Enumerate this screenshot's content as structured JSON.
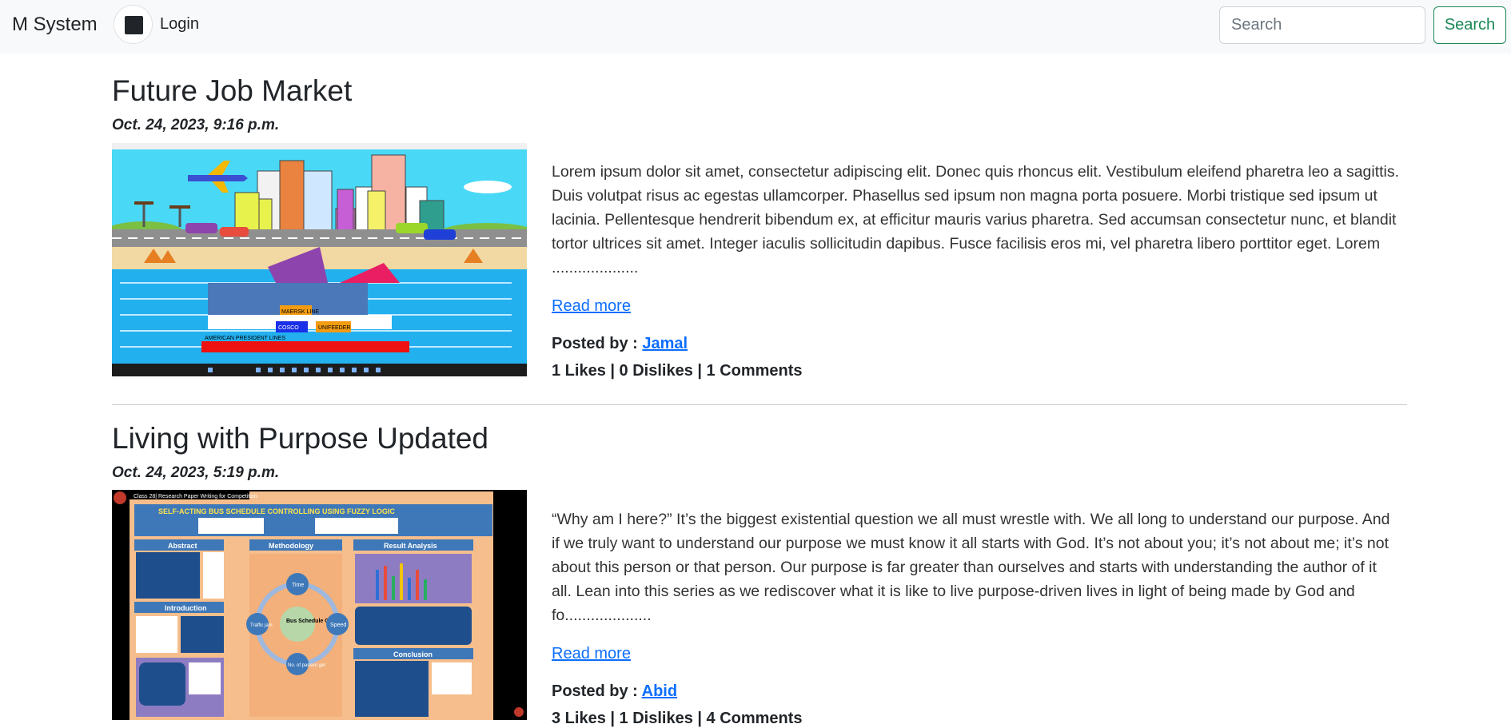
{
  "navbar": {
    "brand": "M System",
    "login_label": "Login",
    "search_placeholder": "Search",
    "search_button": "Search"
  },
  "posts": [
    {
      "title": "Future Job Market",
      "date": "Oct. 24, 2023, 9:16 p.m.",
      "excerpt": "Lorem ipsum dolor sit amet, consectetur adipiscing elit. Donec quis rhoncus elit. Vestibulum eleifend pharetra leo a sagittis. Duis volutpat risus ac egestas ullamcorper. Phasellus sed ipsum non magna porta posuere. Morbi tristique sed ipsum ut lacinia. Pellentesque hendrerit bibendum ex, at efficitur mauris varius pharetra. Sed accumsan consectetur nunc, et blandit tortor ultrices sit amet. Integer iaculis sollicitudin dapibus. Fusce facilisis eros mi, vel pharetra libero porttitor eget. Lorem ....................",
      "read_more": "Read more",
      "posted_by_label": "Posted by :",
      "author": "Jamal",
      "stats": "1 Likes | 0 Dislikes | 1 Comments",
      "image_labels": [
        "MAERSK LINE",
        "COSCO",
        "UNIFEEDER",
        "AMERICAN PRESIDENT LINES"
      ]
    },
    {
      "title": "Living with Purpose Updated",
      "date": "Oct. 24, 2023, 5:19 p.m.",
      "excerpt": "“Why am I here?” It’s the biggest existential question we all must wrestle with. We all long to understand our purpose. And if we truly want to understand our purpose we must know it all starts with God. It’s not about you; it’s not about me; it’s not about this person or that person. Our purpose is far greater than ourselves and starts with understanding the author of it all. Lean into this series as we rediscover what it is like to live purpose-driven lives in light of being made by God and fo....................",
      "read_more": "Read more",
      "posted_by_label": "Posted by :",
      "author": "Abid",
      "stats": "3 Likes | 1 Dislikes | 4 Comments",
      "image_labels": {
        "header": "Class 28| Research Paper Writing for Competition",
        "title": "SELF-ACTING BUS SCHEDULE CONTROLLING USING FUZZY LOGIC",
        "abstract": "Abstract",
        "methodology": "Methodology",
        "result": "Result Analysis",
        "introduction": "Introduction",
        "conclusion": "Conclusion",
        "center": "Bus Schedule Control",
        "time": "Time",
        "speed": "Speed",
        "traffic": "Traffic jam",
        "passenger": "No. of passen ger"
      }
    }
  ],
  "colors": {
    "link": "#0d6efd",
    "success": "#198754",
    "navbar_bg": "#f8f9fa"
  }
}
